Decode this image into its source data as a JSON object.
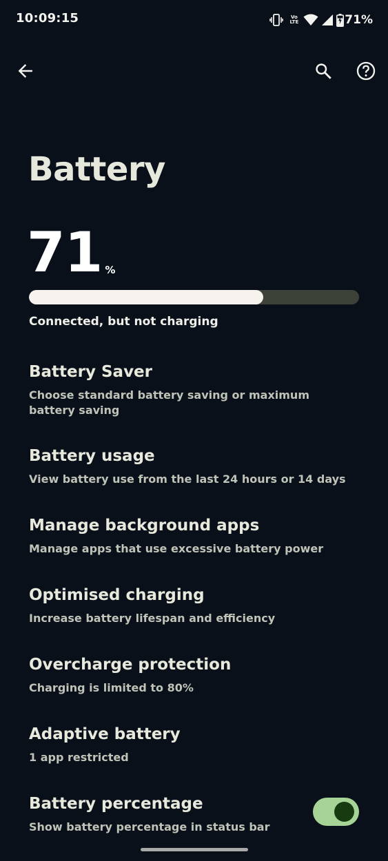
{
  "status_bar": {
    "time": "10:09:15",
    "volte_top": "Vo",
    "volte_bottom": "LTE",
    "battery_percent": "71%",
    "icons": [
      "vibrate-icon",
      "volte-icon",
      "wifi-icon",
      "signal-icon",
      "battery-charging-icon"
    ]
  },
  "toolbar": {
    "icons": [
      "back-arrow-icon",
      "search-icon",
      "help-icon"
    ]
  },
  "page": {
    "title": "Battery",
    "battery_level": "71",
    "battery_unit": "%",
    "battery_fraction": 0.71,
    "charge_status": "Connected, but not charging"
  },
  "preferences": [
    {
      "title": "Battery Saver",
      "summary": "Choose standard battery saving or maximum battery saving"
    },
    {
      "title": "Battery usage",
      "summary": "View battery use from the last 24 hours or 14 days"
    },
    {
      "title": "Manage background apps",
      "summary": "Manage apps that use excessive battery power"
    },
    {
      "title": "Optimised charging",
      "summary": "Increase battery lifespan and efficiency"
    },
    {
      "title": "Overcharge protection",
      "summary": "Charging is limited to 80%"
    },
    {
      "title": "Adaptive battery",
      "summary": "1 app restricted"
    },
    {
      "title": "Battery percentage",
      "summary": "Show battery percentage in status bar",
      "toggle_on": true
    }
  ],
  "colors": {
    "background": "#0a101a",
    "progress_fill": "#f6f3ef",
    "progress_track": "#3c4238",
    "toggle_track": "#a6d396",
    "toggle_thumb": "#173a11"
  }
}
